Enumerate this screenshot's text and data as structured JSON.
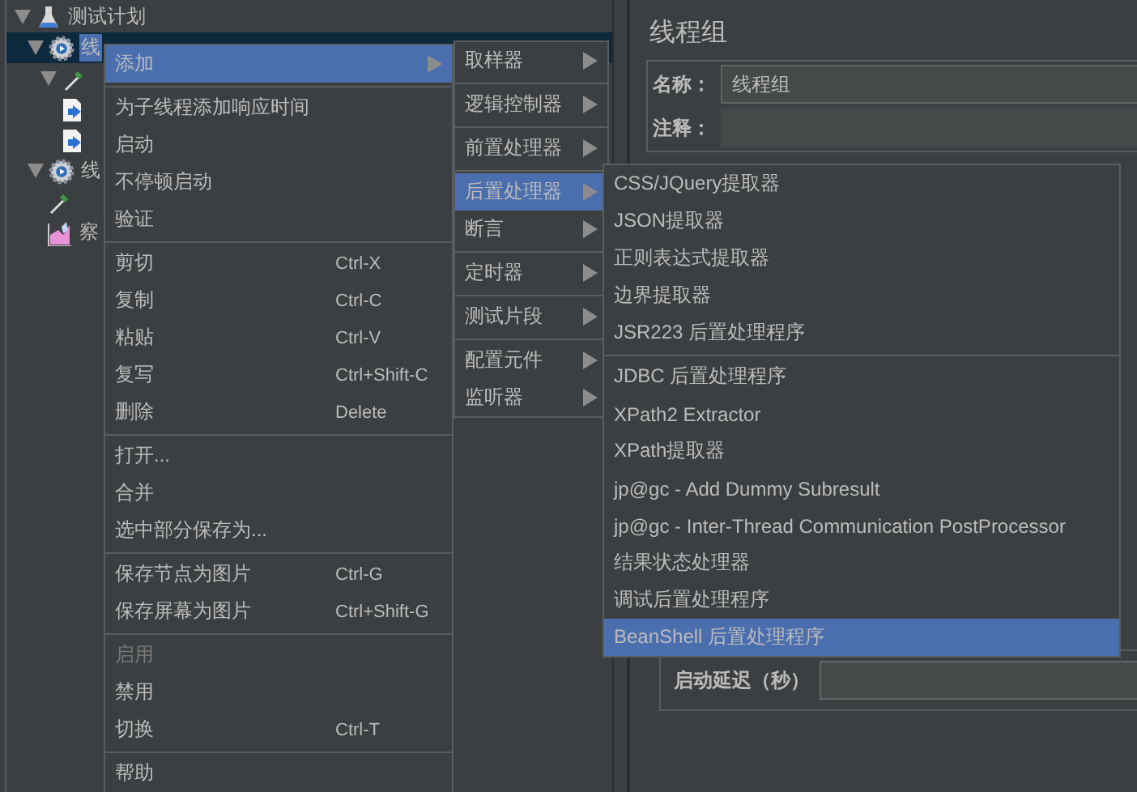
{
  "tree": [
    {
      "label": "测试计划",
      "kind": "plan",
      "expanded": true,
      "selected": false,
      "children": [
        {
          "label": "线",
          "kind": "thread-group",
          "expanded": true,
          "selected": true,
          "children": [
            {
              "kind": "sampler",
              "expanded": true,
              "selected": false,
              "children": [
                {
                  "kind": "config",
                  "selected": false
                },
                {
                  "kind": "config",
                  "selected": false
                }
              ]
            }
          ]
        },
        {
          "label": "线",
          "kind": "thread-group",
          "expanded": true,
          "selected": false,
          "children": [
            {
              "kind": "sampler",
              "selected": false
            },
            {
              "label": "察",
              "kind": "listener",
              "selected": false
            }
          ]
        }
      ]
    }
  ],
  "panel": {
    "title": "线程组",
    "name_label": "名称：",
    "name_value": "线程组",
    "comment_label": "注释：",
    "delay_label": "启动延迟（秒）"
  },
  "menus": [
    {
      "groups": [
        [
          {
            "label": "添加",
            "submenu": true,
            "selected": true,
            "disabled": false
          }
        ],
        [
          {
            "label": "为子线程添加响应时间",
            "submenu": false,
            "selected": false,
            "disabled": false
          },
          {
            "label": "启动",
            "submenu": false,
            "selected": false,
            "disabled": false
          },
          {
            "label": "不停顿启动",
            "submenu": false,
            "selected": false,
            "disabled": false
          },
          {
            "label": "验证",
            "submenu": false,
            "selected": false,
            "disabled": false
          }
        ],
        [
          {
            "label": "剪切",
            "shortcut": "Ctrl-X",
            "submenu": false,
            "selected": false,
            "disabled": false
          },
          {
            "label": "复制",
            "shortcut": "Ctrl-C",
            "submenu": false,
            "selected": false,
            "disabled": false
          },
          {
            "label": "粘贴",
            "shortcut": "Ctrl-V",
            "submenu": false,
            "selected": false,
            "disabled": false
          },
          {
            "label": "复写",
            "shortcut": "Ctrl+Shift-C",
            "submenu": false,
            "selected": false,
            "disabled": false
          },
          {
            "label": "删除",
            "shortcut": "Delete",
            "submenu": false,
            "selected": false,
            "disabled": false
          }
        ],
        [
          {
            "label": "打开...",
            "submenu": false,
            "selected": false,
            "disabled": false
          },
          {
            "label": "合并",
            "submenu": false,
            "selected": false,
            "disabled": false
          },
          {
            "label": "选中部分保存为...",
            "submenu": false,
            "selected": false,
            "disabled": false
          }
        ],
        [
          {
            "label": "保存节点为图片",
            "shortcut": "Ctrl-G",
            "submenu": false,
            "selected": false,
            "disabled": false
          },
          {
            "label": "保存屏幕为图片",
            "shortcut": "Ctrl+Shift-G",
            "submenu": false,
            "selected": false,
            "disabled": false
          }
        ],
        [
          {
            "label": "启用",
            "submenu": false,
            "selected": false,
            "disabled": true
          },
          {
            "label": "禁用",
            "submenu": false,
            "selected": false,
            "disabled": false
          },
          {
            "label": "切换",
            "shortcut": "Ctrl-T",
            "submenu": false,
            "selected": false,
            "disabled": false
          }
        ],
        [
          {
            "label": "帮助",
            "submenu": false,
            "selected": false,
            "disabled": false
          }
        ]
      ]
    },
    {
      "groups": [
        [
          {
            "label": "取样器",
            "submenu": true,
            "selected": false
          }
        ],
        [
          {
            "label": "逻辑控制器",
            "submenu": true,
            "selected": false
          }
        ],
        [
          {
            "label": "前置处理器",
            "submenu": true,
            "selected": false
          }
        ],
        [
          {
            "label": "后置处理器",
            "submenu": true,
            "selected": true
          },
          {
            "label": "断言",
            "submenu": true,
            "selected": false
          }
        ],
        [
          {
            "label": "定时器",
            "submenu": true,
            "selected": false
          }
        ],
        [
          {
            "label": "测试片段",
            "submenu": true,
            "selected": false
          }
        ],
        [
          {
            "label": "配置元件",
            "submenu": true,
            "selected": false
          },
          {
            "label": "监听器",
            "submenu": true,
            "selected": false
          }
        ]
      ]
    },
    {
      "groups": [
        [
          {
            "label": "CSS/JQuery提取器",
            "submenu": false,
            "selected": false
          },
          {
            "label": "JSON提取器",
            "submenu": false,
            "selected": false
          },
          {
            "label": "正则表达式提取器",
            "submenu": false,
            "selected": false
          },
          {
            "label": "边界提取器",
            "submenu": false,
            "selected": false
          },
          {
            "label": "JSR223 后置处理程序",
            "submenu": false,
            "selected": false
          }
        ],
        [
          {
            "label": "JDBC 后置处理程序",
            "submenu": false,
            "selected": false
          },
          {
            "label": "XPath2 Extractor",
            "submenu": false,
            "selected": false
          },
          {
            "label": "XPath提取器",
            "submenu": false,
            "selected": false
          },
          {
            "label": "jp@gc - Add Dummy Subresult",
            "submenu": false,
            "selected": false
          },
          {
            "label": "jp@gc - Inter-Thread Communication PostProcessor",
            "submenu": false,
            "selected": false
          },
          {
            "label": "结果状态处理器",
            "submenu": false,
            "selected": false
          },
          {
            "label": "调试后置处理程序",
            "submenu": false,
            "selected": false
          },
          {
            "label": "BeanShell 后置处理程序",
            "submenu": false,
            "selected": true
          }
        ]
      ]
    }
  ]
}
